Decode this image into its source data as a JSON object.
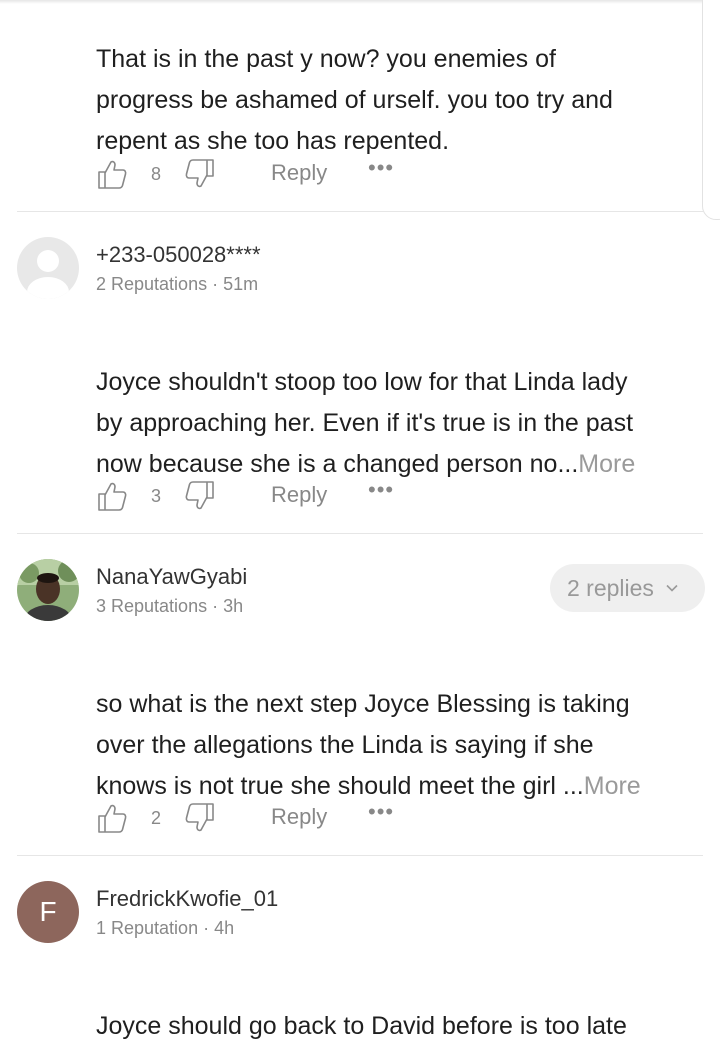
{
  "comments": [
    {
      "body": "That is in the past y now? you enemies of\nprogress be ashamed of urself. you too try and\nrepent as she too has repented.",
      "likes": "8",
      "reply_label": "Reply",
      "more_icon": "ellipsis-icon"
    },
    {
      "username": "+233-050028****",
      "reputation": "2 Reputations · 51m",
      "avatar": "default-avatar-icon",
      "body": "Joyce shouldn't stoop too low for that Linda lady\nby approaching her. Even if it's true is in the past\nnow because she is a changed person no...",
      "more_label": "More",
      "likes": "3",
      "reply_label": "Reply"
    },
    {
      "username": "NanaYawGyabi",
      "reputation": "3 Reputations · 3h",
      "avatar": "profile-photo",
      "replies_label": "2 replies",
      "body": "so what is the next step Joyce Blessing is taking\nover the allegations the Linda is saying if she\nknows is not true she should meet the girl ...",
      "more_label": "More",
      "likes": "2",
      "reply_label": "Reply"
    },
    {
      "username": "FredrickKwofie_01",
      "reputation": "1 Reputation · 4h",
      "avatar_letter": "F",
      "avatar_color": "#8d665c",
      "body": "Joyce should go back to David  before is too late"
    }
  ],
  "icons": {
    "like": "thumbs-up-icon",
    "dislike": "thumbs-down-icon",
    "more": "ellipsis-icon",
    "chevron": "chevron-down-icon"
  },
  "colors": {
    "text": "#1f1f1f",
    "muted": "#888888",
    "more_link": "#9a9a9a",
    "pill_bg": "#efefef",
    "divider": "#e6e6e6"
  }
}
